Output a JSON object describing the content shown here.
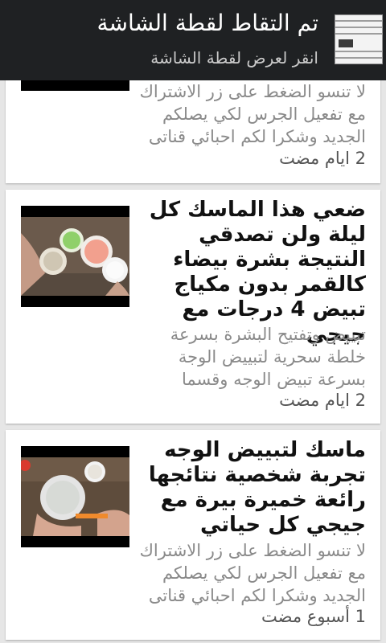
{
  "notification": {
    "title": "تم التقاط لقطة الشاشة",
    "subtitle": "انقر لعرض لقطة الشاشة",
    "thumbnail_icon": "screenshot-thumbnail"
  },
  "cards": [
    {
      "title": "",
      "description": "لا تنسو الضغط على زر الاشتراك مع تفعيل الجرس لكي يصلكم الجديد وشكرا لكم احبائي قناتى",
      "time": "2 ايام مضت"
    },
    {
      "title": "ضعي هذا الماسك كل ليلة ولن تصدقي النتيجة بشرة بيضاء كالقمر بدون مكياج تبيض 4 درجات  مع جيجي",
      "description": "تبييض وتفتيح البشرة بسرعة خلطة سحرية لتبييض الوجة بسرعة تبيض الوجه وقسما",
      "time": "2 ايام مضت"
    },
    {
      "title": "ماسك لتبييض الوجه تجربة شخصية نتائجها رائعة خميرة بيرة مع جيجي كل حياتي",
      "description": "لا تنسو الضغط على زر الاشتراك مع تفعيل الجرس لكي يصلكم الجديد وشكرا لكم احبائي قناتى",
      "time": "1 أسبوع مضت"
    }
  ]
}
